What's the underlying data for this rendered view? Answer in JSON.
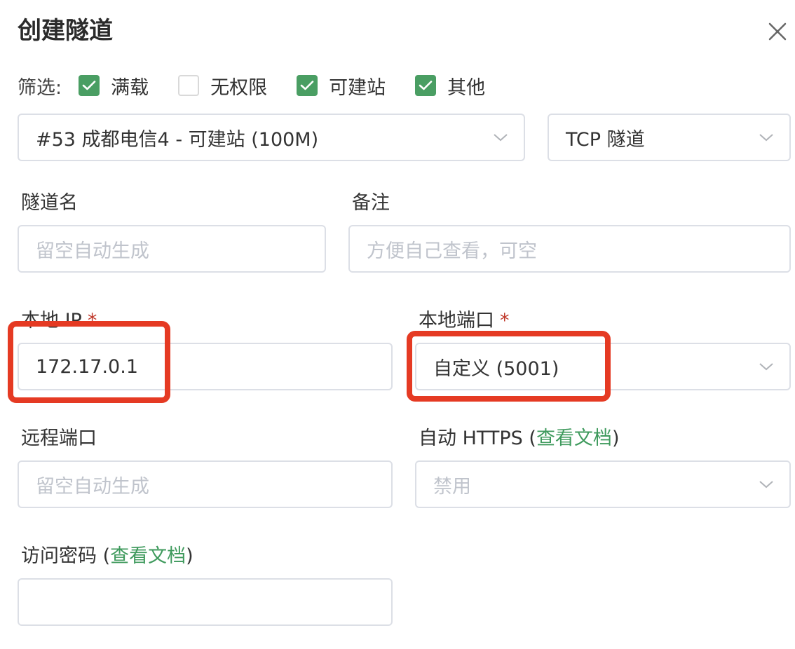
{
  "dialog": {
    "title": "创建隧道"
  },
  "filter": {
    "label": "筛选:",
    "options": [
      {
        "label": "满载",
        "checked": true
      },
      {
        "label": "无权限",
        "checked": false
      },
      {
        "label": "可建站",
        "checked": true
      },
      {
        "label": "其他",
        "checked": true
      }
    ]
  },
  "node_select": {
    "value": "#53 成都电信4 - 可建站 (100M)"
  },
  "type_select": {
    "value": "TCP 隧道"
  },
  "tunnel_name": {
    "label": "隧道名",
    "placeholder": "留空自动生成"
  },
  "remark": {
    "label": "备注",
    "placeholder": "方便自己查看，可空"
  },
  "local_ip": {
    "label": "本地 IP",
    "required_mark": "*",
    "value": "172.17.0.1"
  },
  "local_port": {
    "label": "本地端口",
    "required_mark": "*",
    "value": "自定义 (5001)"
  },
  "remote_port": {
    "label": "远程端口",
    "placeholder": "留空自动生成"
  },
  "auto_https": {
    "label_prefix": "自动 HTTPS (",
    "link_text": "查看文档",
    "label_suffix": ")",
    "value": "禁用"
  },
  "access_password": {
    "label_prefix": "访问密码 (",
    "link_text": "查看文档",
    "label_suffix": ")",
    "value": ""
  },
  "colors": {
    "accent": "#4a9e63",
    "link": "#3f9a5d",
    "highlight": "#e53a23",
    "required": "#c0392b"
  }
}
